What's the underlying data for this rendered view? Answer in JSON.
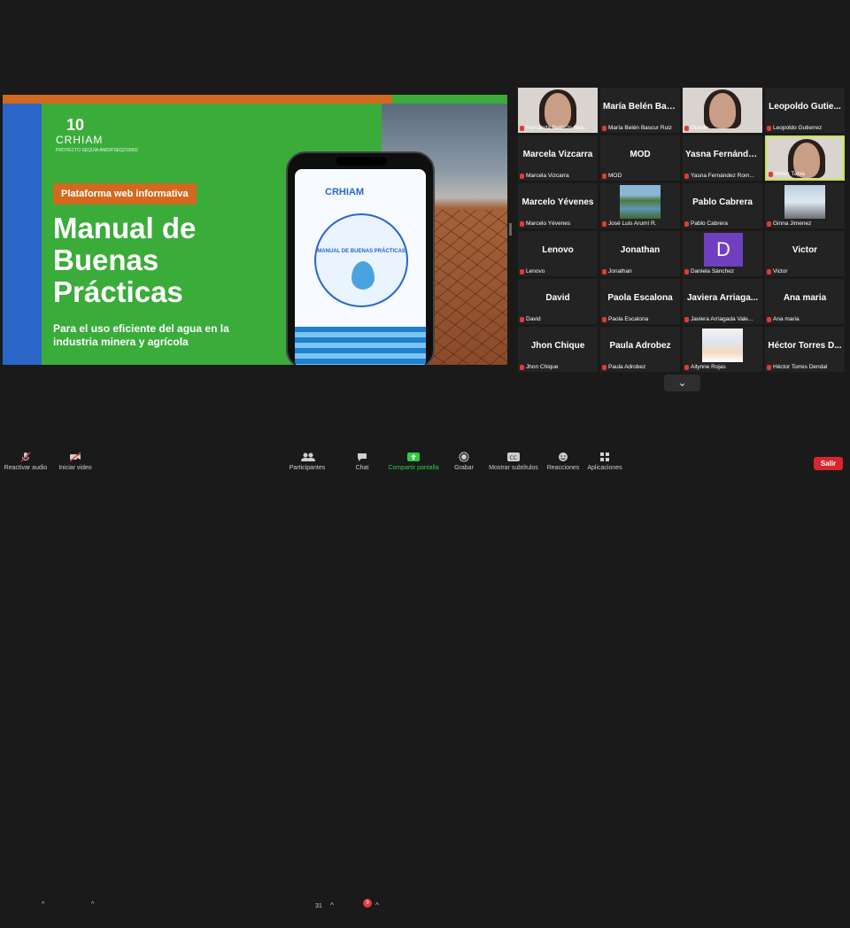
{
  "slide": {
    "logo_number": "10",
    "logo_brand": "CRHIAM",
    "project": "PROYECTO SEQUÍA ANID/FSEQ210002",
    "badge": "Plataforma web informativa",
    "title": "Manual de Buenas Prácticas",
    "subtitle": "Para el uso eficiente del agua en la industria minera y agrícola",
    "phone_logo": "CRHIAM",
    "phone_circle": "MANUAL DE BUENAS PRÁCTICAS"
  },
  "participants": [
    {
      "name": "",
      "label": "Fernanda BelÃ©n Sep...",
      "video": true
    },
    {
      "name": "María Belén Bas...",
      "label": "María Belén Bascur Ruiz"
    },
    {
      "name": "",
      "label": "Giselle",
      "video": true
    },
    {
      "name": "Leopoldo Gutie...",
      "label": "Leopoldo Gutierrez"
    },
    {
      "name": "Marcela Vizcarra",
      "label": "Marcela Vizcarra"
    },
    {
      "name": "MOD",
      "label": "MOD"
    },
    {
      "name": "Yasna Fernánde...",
      "label": "Yasna Fernández Rom..."
    },
    {
      "name": "",
      "label": "Belén Tapia",
      "video": true,
      "active": true
    },
    {
      "name": "Marcelo Yévenes",
      "label": "Marcelo Yévenes"
    },
    {
      "name": "",
      "label": "José Luis Arumí R.",
      "thumb": "river"
    },
    {
      "name": "Pablo Cabrera",
      "label": "Pablo Cabrera"
    },
    {
      "name": "",
      "label": "Ginna Jimenez",
      "thumb": "city"
    },
    {
      "name": "Lenovo",
      "label": "Lenovo"
    },
    {
      "name": "Jonathan",
      "label": "Jonathan"
    },
    {
      "name": "",
      "label": "Daniela Sánchez",
      "avatar": "D"
    },
    {
      "name": "Victor",
      "label": "Victor"
    },
    {
      "name": "David",
      "label": "David"
    },
    {
      "name": "Paola Escalona",
      "label": "Paola Escalona"
    },
    {
      "name": "Javiera Arriaga...",
      "label": "Javiera Arriagada Vale..."
    },
    {
      "name": "Ana maria",
      "label": "Ana maria"
    },
    {
      "name": "Jhon Chique",
      "label": "Jhon Chique"
    },
    {
      "name": "Paula Adrobez",
      "label": "Paula Adrobez"
    },
    {
      "name": "",
      "label": "Ailynne Rojas",
      "thumb": "anime"
    },
    {
      "name": "Héctor Torres D...",
      "label": "Héctor Torres Dendal"
    }
  ],
  "toolbar": {
    "audio": "Reactivar audio",
    "video": "Iniciar video",
    "participants": "Participantes",
    "participants_count": "31",
    "chat": "Chat",
    "chat_badge": "9",
    "share": "Compartir pantalla",
    "record": "Grabar",
    "captions": "Mostrar subtítulos",
    "reactions": "Reacciones",
    "apps": "Aplicaciones",
    "leave": "Salir"
  },
  "colors": {
    "slide_green": "#3aac3a",
    "slide_orange": "#d2691e",
    "slide_blue": "#2a66c7",
    "share_green": "#2ecc40",
    "leave_red": "#d7262f",
    "active_border": "#c9e44b"
  },
  "icons": {
    "audio": "mic-muted-icon",
    "video": "video-off-icon",
    "participants": "participants-icon",
    "chat": "chat-icon",
    "share": "share-screen-icon",
    "record": "record-icon",
    "captions": "captions-icon",
    "reactions": "reactions-icon",
    "apps": "apps-icon",
    "more": "chevron-down-icon"
  }
}
